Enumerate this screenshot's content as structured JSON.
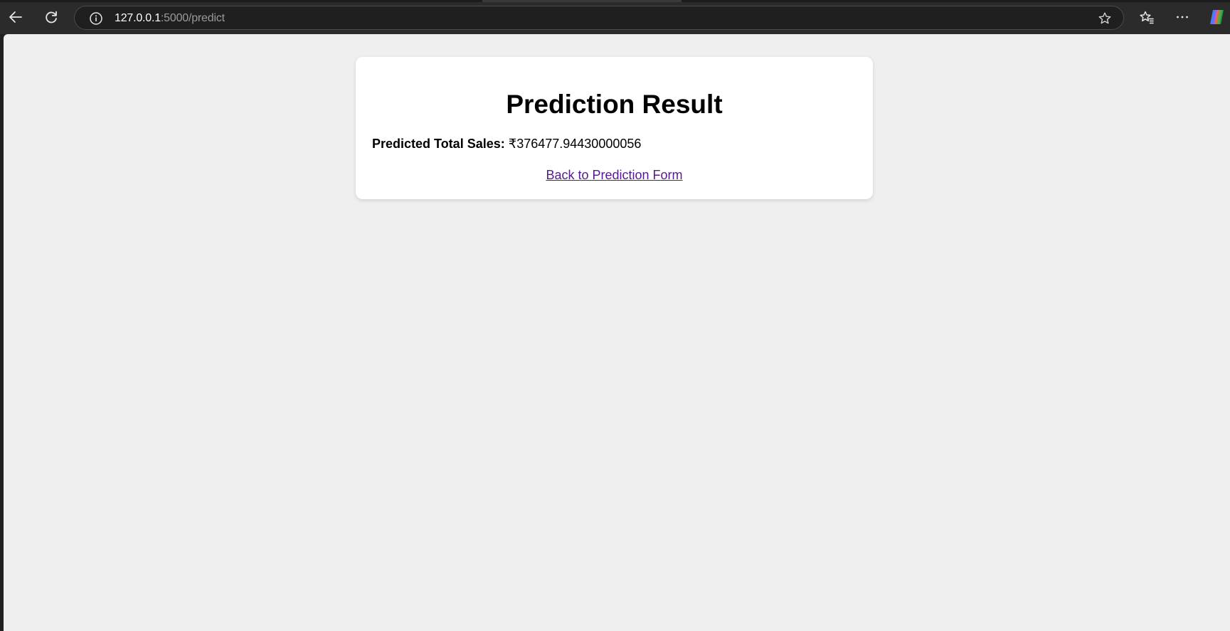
{
  "browser": {
    "address": {
      "host": "127.0.0.1",
      "path": ":5000/predict"
    },
    "icons": {
      "back": "back-arrow-icon",
      "refresh": "refresh-icon",
      "site_info": "info-icon",
      "favorite": "star-icon",
      "favorites_list": "favorites-icon",
      "more": "more-dots-icon",
      "copilot": "copilot-icon"
    }
  },
  "page": {
    "title": "Prediction Result",
    "result_label": "Predicted Total Sales:",
    "result_value": "₹376477.94430000056",
    "back_link": "Back to Prediction Form"
  },
  "colors": {
    "chrome_bg": "#2b2b2b",
    "page_bg": "#efefef",
    "card_bg": "#ffffff",
    "link_visited": "#551a8b"
  }
}
